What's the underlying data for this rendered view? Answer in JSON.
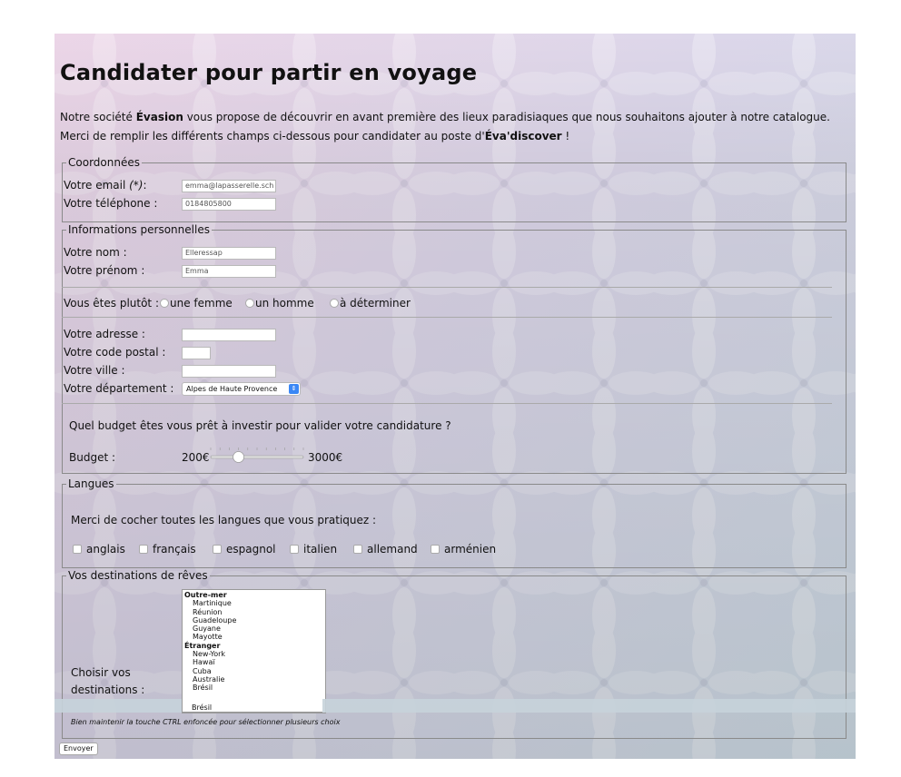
{
  "title": "Candidater pour partir en voyage",
  "intro": {
    "p1": "Notre société ",
    "brand": "Évasion",
    "p2": " vous propose de découvrir en avant première des lieux paradisiaques que nous souhaitons ajouter à notre catalogue. Merci de remplir les différents champs ci-dessous pour candidater au poste d'",
    "role": "Éva'discover",
    "p3": " !"
  },
  "coordonnees": {
    "legend": "Coordonnées",
    "email_label": "Votre email ",
    "email_required": "(*)",
    "email_suffix": ":",
    "email_value": "emma@lapasserelle.sch",
    "phone_label": "Votre téléphone :",
    "phone_value": "0184805800"
  },
  "perso": {
    "legend": "Informations personnelles",
    "nom_label": "Votre nom :",
    "nom_value": "Elleressap",
    "prenom_label": "Votre prénom :",
    "prenom_value": "Emma",
    "gender_label": "Vous êtes plutôt :",
    "gender_options": [
      "une femme",
      "un homme",
      "à déterminer"
    ],
    "adresse_label": "Votre adresse :",
    "cp_label": "Votre code postal :",
    "ville_label": "Votre ville :",
    "dept_label": "Votre département :",
    "dept_value": "Alpes de Haute Provence",
    "budget_question": "Quel budget êtes vous prêt à investir pour valider votre candidature ?",
    "budget_label": "Budget :",
    "budget_min": "200€",
    "budget_max": "3000€",
    "budget_position_fraction": 0.3
  },
  "langues": {
    "legend": "Langues",
    "question": "Merci de cocher toutes les langues que vous pratiquez :",
    "options": [
      "anglais",
      "français",
      "espagnol",
      "italien",
      "allemand",
      "arménien"
    ]
  },
  "destinations": {
    "legend": "Vos destinations de rêves",
    "label_line1": "Choisir vos",
    "label_line2": "destinations :",
    "group1": "Outre-mer",
    "group1_items": [
      "Martinique",
      "Réunion",
      "Guadeloupe",
      "Guyane",
      "Mayotte"
    ],
    "group2": "Étranger",
    "group2_items": [
      "New-York",
      "Hawaï",
      "Cuba",
      "Australie",
      "Brésil"
    ],
    "hint": "Bien maintenir la touche CTRL enfoncée pour sélectionner plusieurs choix"
  },
  "submit_label": "Envoyer",
  "colors": {
    "text": "#111111",
    "select_accent": "#3a87f5",
    "border": "#8a8a8a"
  }
}
